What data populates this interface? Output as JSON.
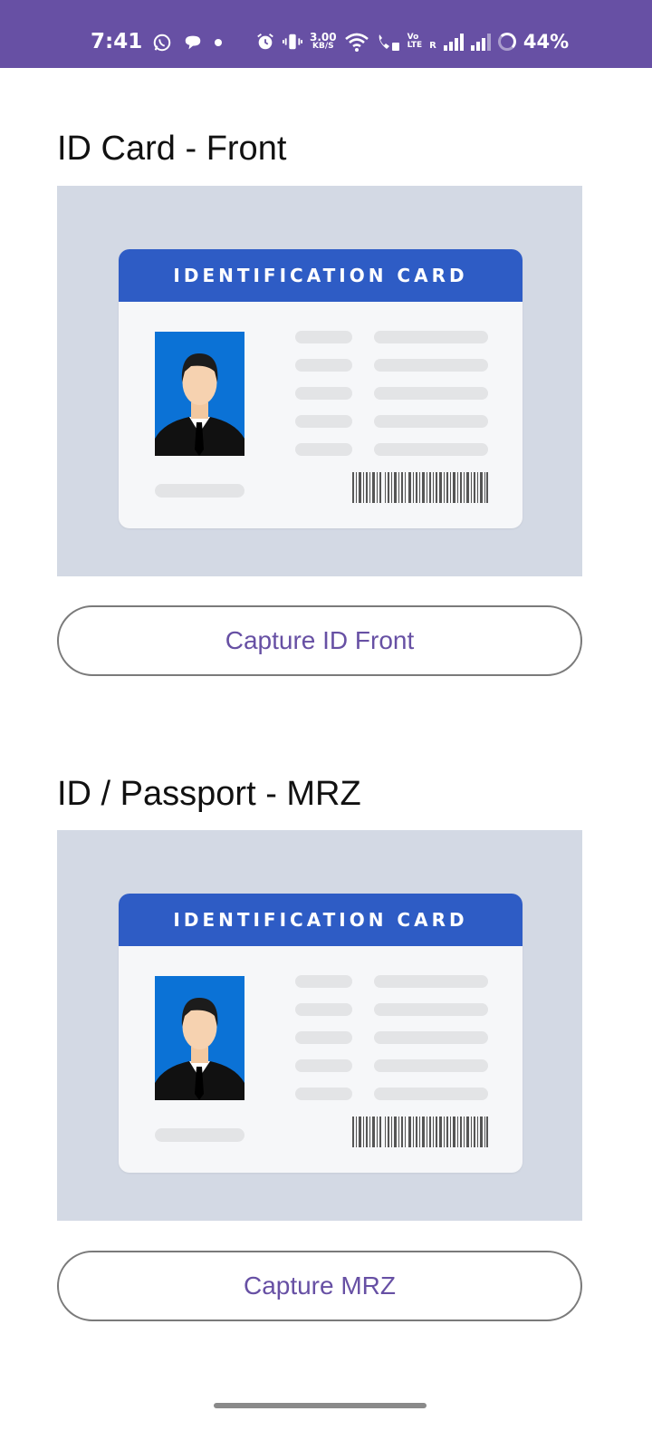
{
  "status_bar": {
    "time": "7:41",
    "icons_left": [
      "whatsapp-icon",
      "chat-bubble-icon",
      "dot-icon"
    ],
    "icons_right": [
      "alarm-icon",
      "vibrate-icon",
      "wifi-icon",
      "wifi-call-icon"
    ],
    "speed_value": "3.00",
    "speed_unit": "KB/S",
    "volte_top": "Vo",
    "volte_bottom": "LTE",
    "roaming": "R",
    "battery": "44%"
  },
  "sections": [
    {
      "title": "ID Card - Front",
      "card_header": "IDENTIFICATION CARD",
      "button_label": "Capture ID Front"
    },
    {
      "title": "ID / Passport - MRZ",
      "card_header": "IDENTIFICATION CARD",
      "button_label": "Capture MRZ"
    }
  ],
  "colors": {
    "accent": "#6750a4",
    "card_header": "#2e5cc5",
    "preview_bg": "#d3d9e4",
    "photo_bg": "#0b72d6"
  }
}
